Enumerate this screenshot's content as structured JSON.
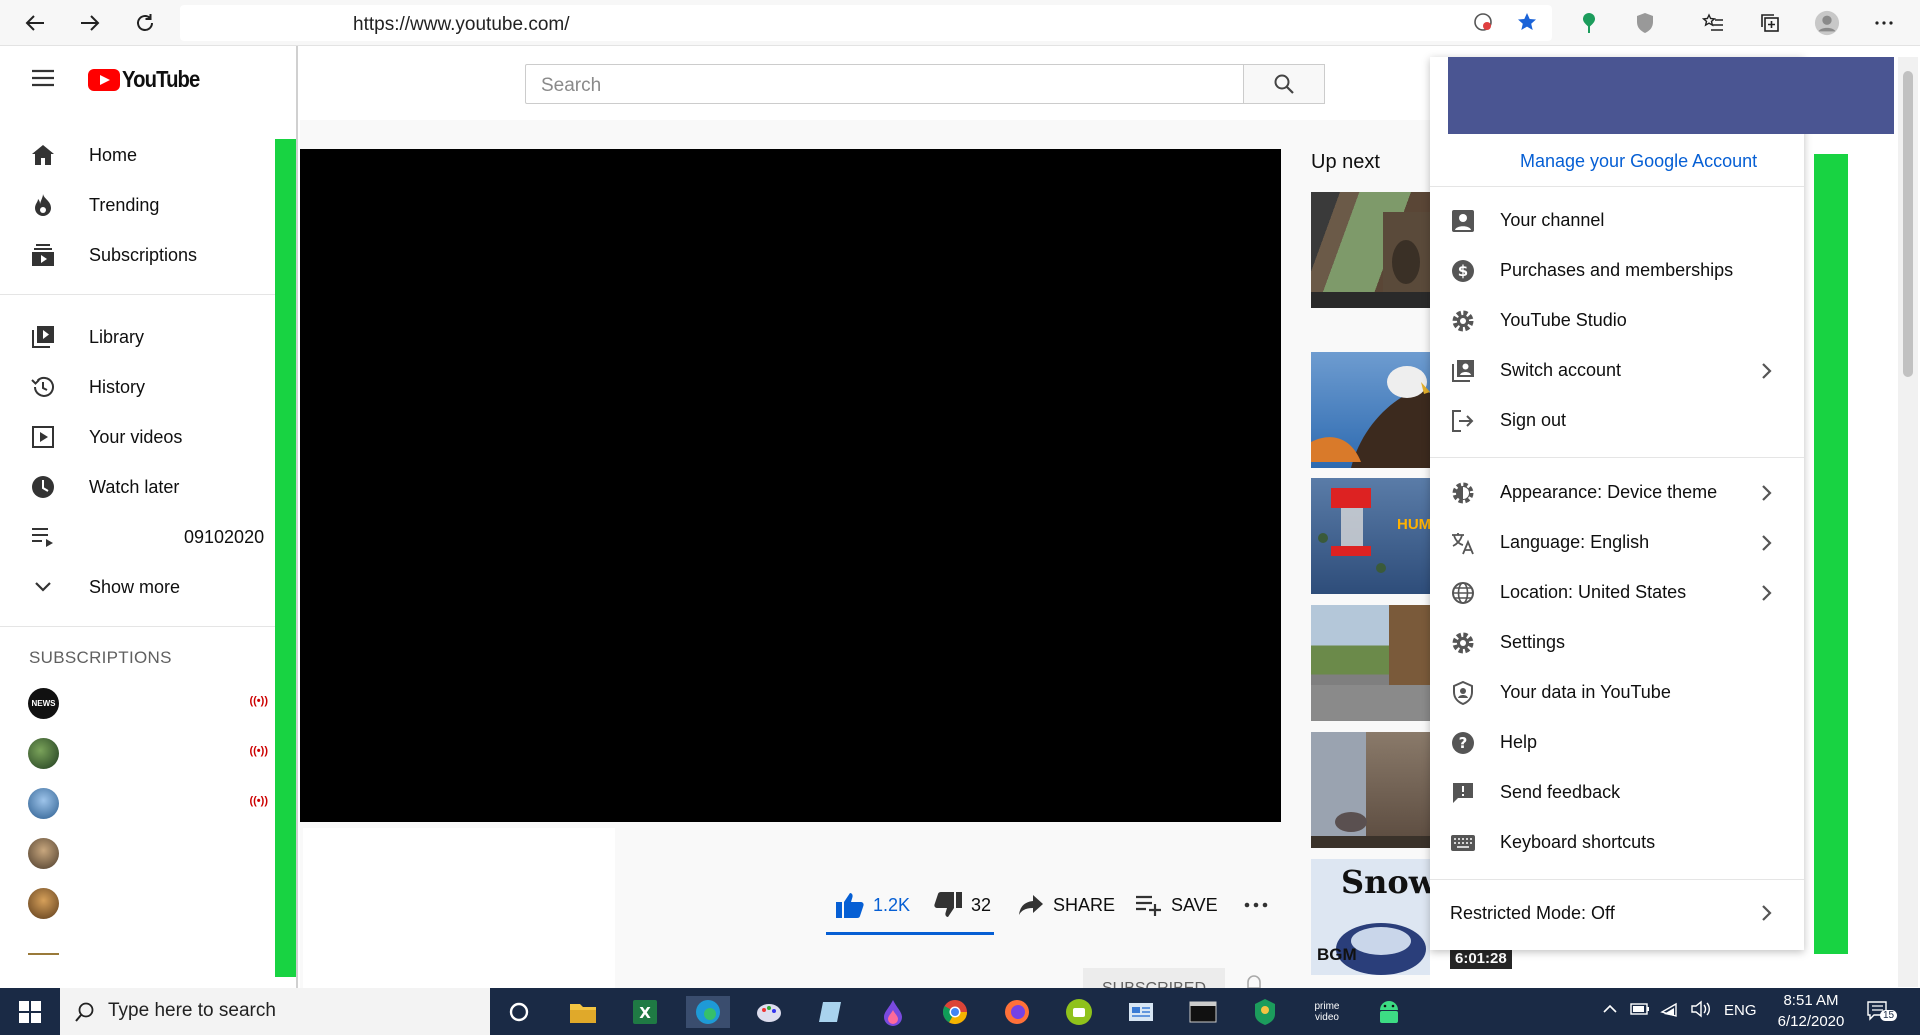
{
  "browser": {
    "url": "https://www.youtube.com/"
  },
  "sidebar": {
    "logo_text": "YouTube",
    "items": [
      {
        "label": "Home",
        "icon": "home-icon"
      },
      {
        "label": "Trending",
        "icon": "fire-icon"
      },
      {
        "label": "Subscriptions",
        "icon": "subscriptions-icon"
      },
      {
        "label": "Library",
        "icon": "library-icon"
      },
      {
        "label": "History",
        "icon": "history-icon"
      },
      {
        "label": "Your videos",
        "icon": "your-videos-icon"
      },
      {
        "label": "Watch later",
        "icon": "clock-icon"
      },
      {
        "label": "09102020",
        "icon": "playlist-icon"
      },
      {
        "label": "Show more",
        "icon": "chevron-down-icon"
      }
    ],
    "subscriptions_heading": "SUBSCRIPTIONS",
    "channel_avatar_text": "NEWS"
  },
  "search": {
    "placeholder": "Search"
  },
  "video": {
    "likes": "1.2K",
    "dislikes": "32",
    "share_label": "SHARE",
    "save_label": "SAVE",
    "subscribed_label": "SUBSCRIBED"
  },
  "upnext": {
    "heading": "Up next",
    "last_thumb_text": "Snow",
    "last_thumb_sub": "BGM",
    "last_thumb_duration": "6:01:28",
    "hummingbird_text": "HUM"
  },
  "account_menu": {
    "manage_link": "Manage your Google Account",
    "group1": [
      {
        "label": "Your channel",
        "icon": "person-icon",
        "chevron": false
      },
      {
        "label": "Purchases and memberships",
        "icon": "dollar-icon",
        "chevron": false
      },
      {
        "label": "YouTube Studio",
        "icon": "gear-icon",
        "chevron": false
      },
      {
        "label": "Switch account",
        "icon": "switch-account-icon",
        "chevron": true
      },
      {
        "label": "Sign out",
        "icon": "sign-out-icon",
        "chevron": false
      }
    ],
    "group2": [
      {
        "label": "Appearance: Device theme",
        "icon": "appearance-icon",
        "chevron": true
      },
      {
        "label": "Language: English",
        "icon": "translate-icon",
        "chevron": true
      },
      {
        "label": "Location: United States",
        "icon": "globe-icon",
        "chevron": true
      },
      {
        "label": "Settings",
        "icon": "gear-icon",
        "chevron": false
      },
      {
        "label": "Your data in YouTube",
        "icon": "shield-person-icon",
        "chevron": false
      },
      {
        "label": "Help",
        "icon": "help-icon",
        "chevron": false
      },
      {
        "label": "Send feedback",
        "icon": "feedback-icon",
        "chevron": false
      },
      {
        "label": "Keyboard shortcuts",
        "icon": "keyboard-icon",
        "chevron": false
      }
    ],
    "restricted_mode": "Restricted Mode: Off"
  },
  "taskbar": {
    "search_placeholder": "Type here to search",
    "time": "8:51 AM",
    "date": "6/12/2020",
    "language": "ENG",
    "notification_count": "15",
    "prime_label_1": "prime",
    "prime_label_2": "video"
  },
  "colors": {
    "accent_blue": "#065fd4",
    "green_bar": "#18d342",
    "header_purple": "#4a5592",
    "youtube_red": "#ff0000",
    "taskbar": "#1a2a45"
  }
}
